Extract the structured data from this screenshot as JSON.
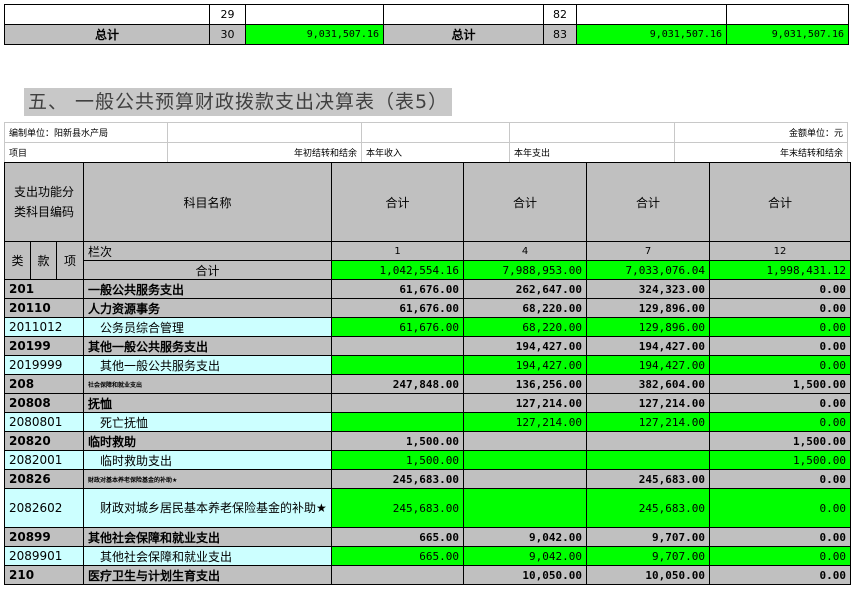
{
  "top": {
    "row1": {
      "left_no": "29",
      "right_no": "82"
    },
    "row2": {
      "left_label": "总计",
      "left_no": "30",
      "left_val": "9,031,507.16",
      "right_label": "总计",
      "right_no": "83",
      "right_val1": "9,031,507.16",
      "right_val2": "9,031,507.16"
    }
  },
  "section_title": "五、 一般公共预算财政拨款支出决算表（表5）",
  "meta": {
    "unit": "编制单位：阳新县水产局",
    "amount_unit": "金额单位：元",
    "item": "项目",
    "begin_balance": "年初结转和结余",
    "income": "本年收入",
    "expense": "本年支出",
    "end_balance": "年末结转和结余"
  },
  "header": {
    "code_col": "支出功能分类科目编码",
    "name_col": "科目名称",
    "sum_label": "合计",
    "lanci": "栏次",
    "col_nums": [
      "1",
      "4",
      "7",
      "12"
    ],
    "lei": "类",
    "kuan": "款",
    "xiang": "项"
  },
  "total_row": {
    "label": "合计",
    "v1": "1,042,554.16",
    "v4": "7,988,953.00",
    "v7": "7,033,076.04",
    "v12": "1,998,431.12"
  },
  "rows": [
    {
      "code": "201",
      "name": "一般公共服务支出",
      "v1": "61,676.00",
      "v4": "262,647.00",
      "v7": "324,323.00",
      "v12": "0.00"
    },
    {
      "code": "20110",
      "name": "人力资源事务",
      "v1": "61,676.00",
      "v4": "68,220.00",
      "v7": "129,896.00",
      "v12": "0.00"
    },
    {
      "code": "2011012",
      "name": "公务员综合管理",
      "v1": "61,676.00",
      "v4": "68,220.00",
      "v7": "129,896.00",
      "v12": "0.00"
    },
    {
      "code": "20199",
      "name": "其他一般公共服务支出",
      "v1": "",
      "v4": "194,427.00",
      "v7": "194,427.00",
      "v12": "0.00"
    },
    {
      "code": "2019999",
      "name": "其他一般公共服务支出",
      "v1": "",
      "v4": "194,427.00",
      "v7": "194,427.00",
      "v12": "0.00"
    },
    {
      "code": "208",
      "name": "社会保障和就业支出",
      "v1": "247,848.00",
      "v4": "136,256.00",
      "v7": "382,604.00",
      "v12": "1,500.00"
    },
    {
      "code": "20808",
      "name": "抚恤",
      "v1": "",
      "v4": "127,214.00",
      "v7": "127,214.00",
      "v12": "0.00"
    },
    {
      "code": "2080801",
      "name": "死亡抚恤",
      "v1": "",
      "v4": "127,214.00",
      "v7": "127,214.00",
      "v12": "0.00"
    },
    {
      "code": "20820",
      "name": "临时救助",
      "v1": "1,500.00",
      "v4": "",
      "v7": "",
      "v12": "1,500.00"
    },
    {
      "code": "2082001",
      "name": "临时救助支出",
      "v1": "1,500.00",
      "v4": "",
      "v7": "",
      "v12": "1,500.00"
    },
    {
      "code": "20826",
      "name": "财政对基本养老保险基金的补助★",
      "v1": "245,683.00",
      "v4": "",
      "v7": "245,683.00",
      "v12": "0.00"
    },
    {
      "code": "2082602",
      "name": "财政对城乡居民基本养老保险基金的补助★",
      "v1": "245,683.00",
      "v4": "",
      "v7": "245,683.00",
      "v12": "0.00"
    },
    {
      "code": "20899",
      "name": "其他社会保障和就业支出",
      "v1": "665.00",
      "v4": "9,042.00",
      "v7": "9,707.00",
      "v12": "0.00"
    },
    {
      "code": "2089901",
      "name": "其他社会保障和就业支出",
      "v1": "665.00",
      "v4": "9,042.00",
      "v7": "9,707.00",
      "v12": "0.00"
    },
    {
      "code": "210",
      "name": "医疗卫生与计划生育支出",
      "v1": "",
      "v4": "10,050.00",
      "v7": "10,050.00",
      "v12": "0.00"
    }
  ]
}
